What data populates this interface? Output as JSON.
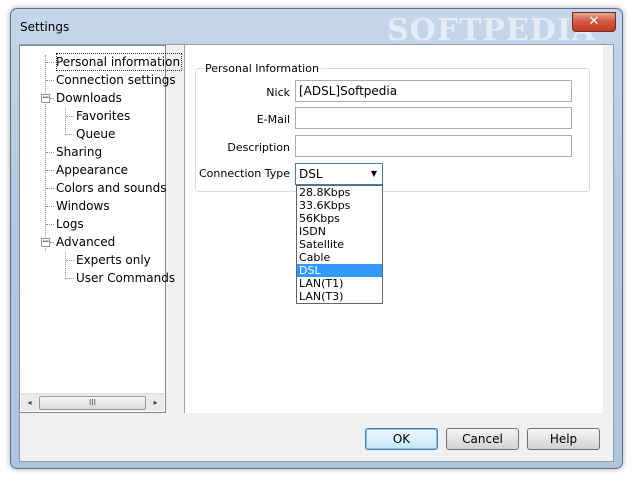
{
  "window": {
    "title": "Settings",
    "watermark": "SOFTPEDIA",
    "close_glyph": "✕"
  },
  "tree": {
    "items": [
      {
        "label": "Personal information",
        "selected": true
      },
      {
        "label": "Connection settings"
      },
      {
        "label": "Downloads",
        "expander": "−"
      },
      {
        "label": "Favorites"
      },
      {
        "label": "Queue"
      },
      {
        "label": "Sharing"
      },
      {
        "label": "Appearance"
      },
      {
        "label": "Colors and sounds"
      },
      {
        "label": "Windows"
      },
      {
        "label": "Logs"
      },
      {
        "label": "Advanced",
        "expander": "−"
      },
      {
        "label": "Experts only"
      },
      {
        "label": "User Commands"
      }
    ],
    "scrollbar": {
      "left": "◂",
      "right": "▸",
      "thumb": "III"
    }
  },
  "personal": {
    "group_title": "Personal Information",
    "nick_label": "Nick",
    "nick_value": "[ADSL]Softpedia",
    "email_label": "E-Mail",
    "email_value": "",
    "description_label": "Description",
    "description_value": "",
    "connection_label": "Connection Type",
    "connection_value": "DSL",
    "connection_arrow": "▼",
    "connection_options": [
      "28.8Kbps",
      "33.6Kbps",
      "56Kbps",
      "ISDN",
      "Satellite",
      "Cable",
      "DSL",
      "LAN(T1)",
      "LAN(T3)"
    ],
    "connection_selected_index": 6
  },
  "buttons": {
    "ok": "OK",
    "cancel": "Cancel",
    "help": "Help"
  }
}
